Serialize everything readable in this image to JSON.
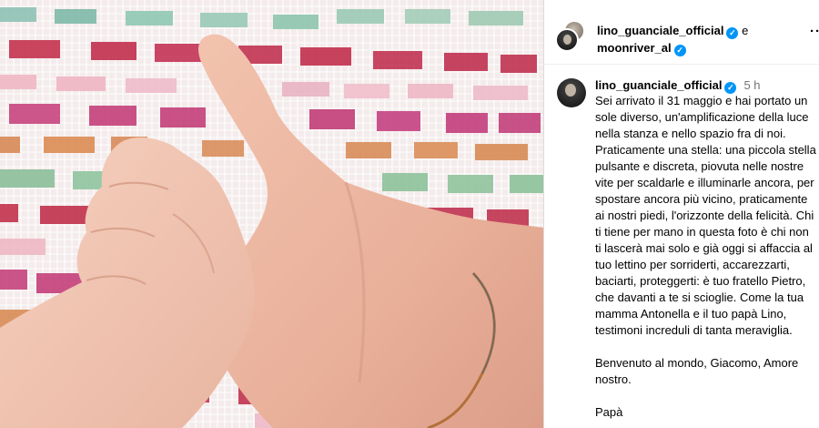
{
  "post": {
    "header": {
      "author1": "lino_guanciale_official",
      "conjunction": "e",
      "author2": "moonriver_al",
      "verified_glyph": "✓",
      "more_glyph": "···"
    },
    "caption": {
      "username": "lino_guanciale_official",
      "time": "5 h",
      "text": "Sei arrivato il 31 maggio e hai portato un sole diverso, un'amplificazione della luce nella stanza e nello spazio fra di noi. Praticamente una stella: una piccola stella pulsante e discreta, piovuta nelle nostre vite per scaldarle e illuminarle ancora, per spostare ancora più vicino, praticamente ai nostri piedi, l'orizzonte della felicità. Chi ti tiene per mano in questa foto è chi non ti lascerà mai solo e già oggi si affaccia al tuo lettino per sorriderti, accarezzarti, baciarti, proteggerti: è tuo fratello Pietro, che davanti a te si scioglie. Come la tua mamma Antonella e il tuo papà Lino, testimoni increduli di tanta meraviglia.\n\nBenvenuto al mondo, Giacomo, Amore nostro.\n\nPapà"
    },
    "icons": {
      "verified": "verified-badge-icon",
      "more": "more-options-icon"
    },
    "colors": {
      "verified": "#0095f6",
      "muted_text": "#737373",
      "divider": "#dbdbdb"
    }
  }
}
